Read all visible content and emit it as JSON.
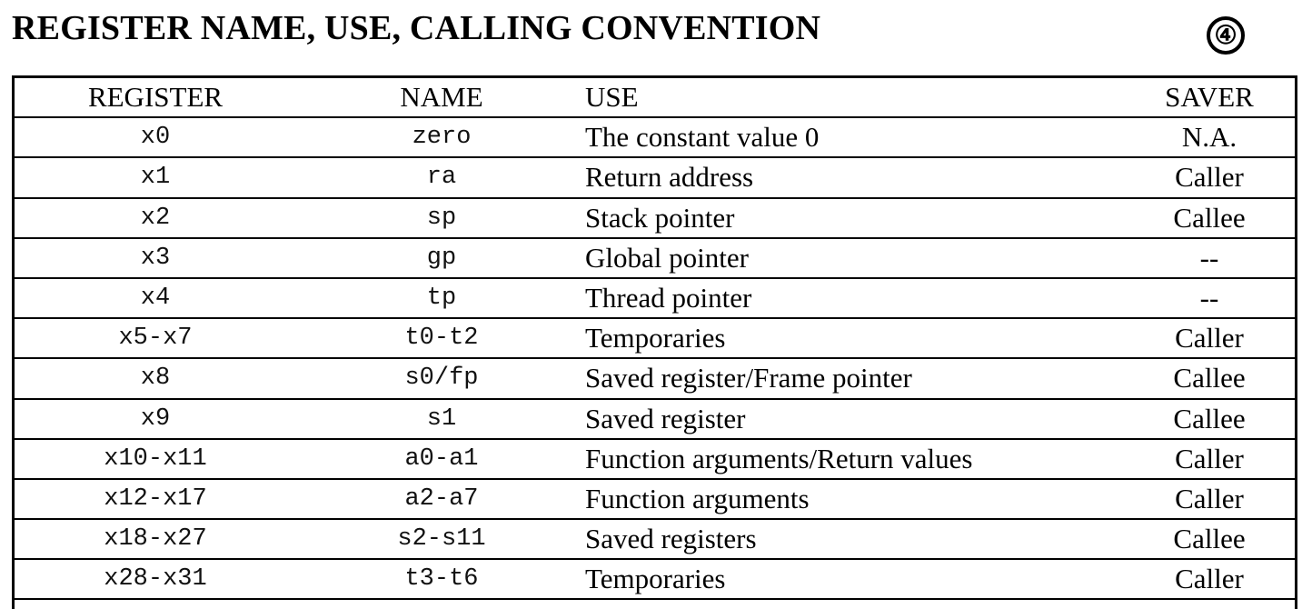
{
  "title": "REGISTER NAME, USE, CALLING CONVENTION",
  "badge": "④",
  "table": {
    "headers": {
      "register": "REGISTER",
      "name": "NAME",
      "use": "USE",
      "saver": "SAVER"
    },
    "rows": [
      {
        "register": "x0",
        "name": "zero",
        "use": "The constant value 0",
        "saver": "N.A."
      },
      {
        "register": "x1",
        "name": "ra",
        "use": "Return address",
        "saver": "Caller"
      },
      {
        "register": "x2",
        "name": "sp",
        "use": "Stack pointer",
        "saver": "Callee"
      },
      {
        "register": "x3",
        "name": "gp",
        "use": "Global pointer",
        "saver": "--"
      },
      {
        "register": "x4",
        "name": "tp",
        "use": "Thread pointer",
        "saver": "--"
      },
      {
        "register": "x5-x7",
        "name": "t0-t2",
        "use": "Temporaries",
        "saver": "Caller"
      },
      {
        "register": "x8",
        "name": "s0/fp",
        "use": "Saved register/Frame pointer",
        "saver": "Callee"
      },
      {
        "register": "x9",
        "name": "s1",
        "use": "Saved register",
        "saver": "Callee"
      },
      {
        "register": "x10-x11",
        "name": "a0-a1",
        "use": "Function arguments/Return values",
        "saver": "Caller"
      },
      {
        "register": "x12-x17",
        "name": "a2-a7",
        "use": "Function arguments",
        "saver": "Caller"
      },
      {
        "register": "x18-x27",
        "name": "s2-s11",
        "use": "Saved registers",
        "saver": "Callee"
      },
      {
        "register": "x28-x31",
        "name": "t3-t6",
        "use": "Temporaries",
        "saver": "Caller"
      }
    ]
  }
}
